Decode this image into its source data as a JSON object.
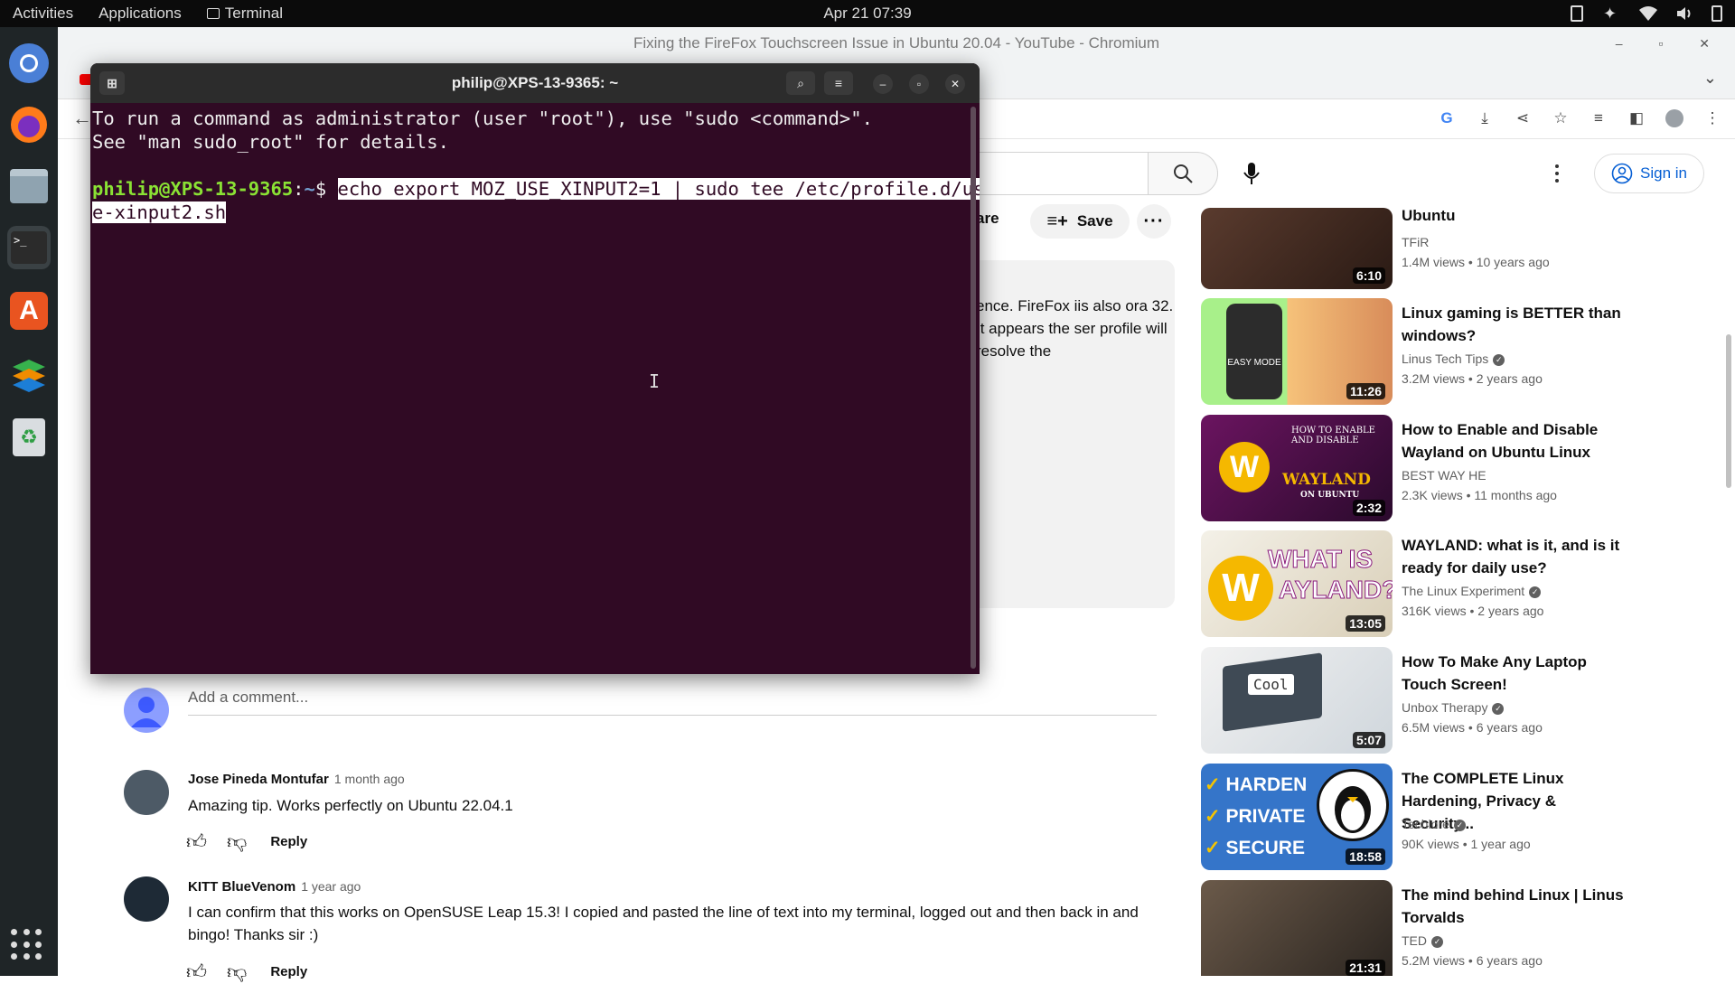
{
  "topbar": {
    "activities": "Activities",
    "applications": "Applications",
    "terminal": "Terminal",
    "clock": "Apr 21  07:39"
  },
  "browser": {
    "window_title": "Fixing the FireFox Touchscreen Issue in Ubuntu 20.04 - YouTube - Chromium"
  },
  "youtube": {
    "signin": "Sign in",
    "share_fragment": "are",
    "save": "Save",
    "description": "ence. FireFox iis also ora 32. It appears the ser profile will resolve the",
    "add_comment": "Add a comment...",
    "comments": [
      {
        "author": "Jose Pineda Montufar",
        "time": "1 month ago",
        "text": "Amazing tip. Works perfectly on Ubuntu 22.04.1",
        "reply": "Reply"
      },
      {
        "author": "KITT BlueVenom",
        "time": "1 year ago",
        "text": "I can confirm that this works on OpenSUSE Leap 15.3! I copied and pasted the line of text into my terminal, logged out and then back in and bingo! Thanks sir :)",
        "reply": "Reply"
      }
    ],
    "recommended": [
      {
        "title": "Ubuntu",
        "channel": "TFiR",
        "meta": "1.4M views  •  10 years ago",
        "duration": "6:10",
        "verified": false
      },
      {
        "title": "Linux gaming is BETTER than windows?",
        "channel": "Linus Tech Tips",
        "meta": "3.2M views  •  2 years ago",
        "duration": "11:26",
        "verified": true
      },
      {
        "title": "How to Enable and Disable Wayland on Ubuntu Linux",
        "channel": "BEST WAY HE",
        "meta": "2.3K views  •  11 months ago",
        "duration": "2:32",
        "verified": false
      },
      {
        "title": "WAYLAND: what is it, and is it ready for daily use?",
        "channel": "The Linux Experiment",
        "meta": "316K views  •  2 years ago",
        "duration": "13:05",
        "verified": true
      },
      {
        "title": "How To Make Any Laptop Touch Screen!",
        "channel": "Unbox Therapy",
        "meta": "6.5M views  •  6 years ago",
        "duration": "5:07",
        "verified": true
      },
      {
        "title": "The COMPLETE Linux Hardening, Privacy & Security...",
        "channel": "Techlore",
        "meta": "90K views  •  1 year ago",
        "duration": "18:58",
        "verified": true
      },
      {
        "title": "The mind behind Linux | Linus Torvalds",
        "channel": "TED",
        "meta": "5.2M views  •  6 years ago",
        "duration": "21:31",
        "verified": true
      }
    ],
    "thumb_text": {
      "easy_mode": "EASY MODE",
      "wayland_howto": "HOW TO ENABLE AND DISABLE",
      "wayland_word": "WAYLAND",
      "wayland_on": "ON UBUNTU",
      "what_is": "WHAT IS",
      "wayland_q": "AYLAND?",
      "cool": "Cool",
      "harden": "HARDEN",
      "private": "PRIVATE",
      "secure": "SECURE"
    }
  },
  "terminal": {
    "title": "philip@XPS-13-9365: ~",
    "line1": "To run a command as administrator (user \"root\"), use \"sudo <command>\".",
    "line2": "See \"man sudo_root\" for details.",
    "prompt_user": "philip@XPS-13-9365",
    "prompt_sep": ":",
    "prompt_path": "~",
    "prompt_dollar": "$ ",
    "command_part1": "echo export MOZ_USE_XINPUT2=1 | sudo tee /etc/profile.d/us",
    "command_part2": "e-xinput2.sh"
  }
}
